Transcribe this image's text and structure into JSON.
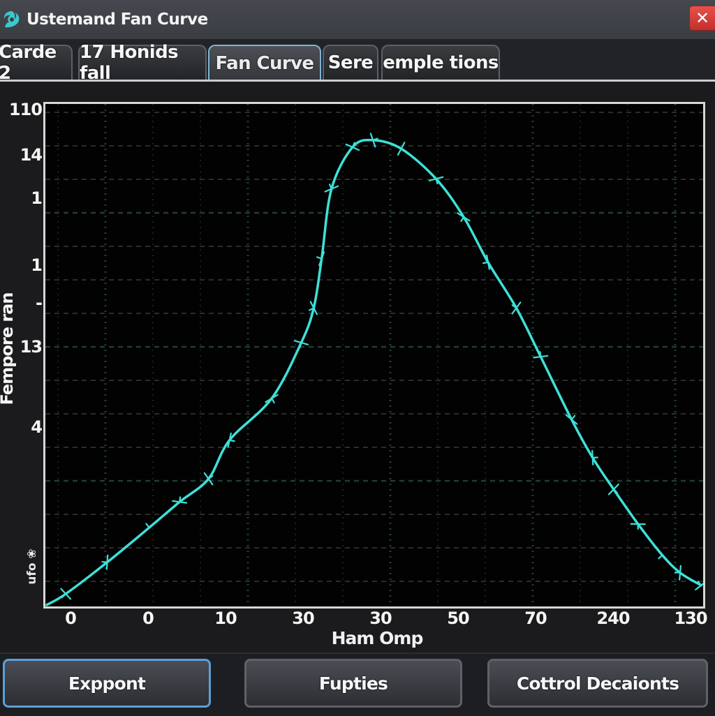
{
  "window": {
    "title": "Ustemand Fan Curve",
    "app_icon": "swirl-fan-icon",
    "close_icon": "close-icon",
    "close_label": "✕"
  },
  "tabs": [
    {
      "label": "Carde 2",
      "active": false
    },
    {
      "label": "17 Honids fall",
      "active": false
    },
    {
      "label": "Fan Curve",
      "active": true
    },
    {
      "label": "Sere",
      "active": false
    },
    {
      "label": "emple tions",
      "active": false
    }
  ],
  "colors": {
    "curve": "#3ee0d8",
    "accent": "#5aa0d8",
    "close": "#d63d38",
    "plot_bg": "#020202",
    "grid": "#3a3a3a"
  },
  "buttons": {
    "export": "Exppont",
    "properties": "Fupties",
    "control": "Cottrol Decaionts"
  },
  "chart_data": {
    "type": "line",
    "title": "",
    "xlabel": "Ham Omp",
    "ylabel": "Fempore ran",
    "ylabel_minor": "ufo ❀",
    "x_tick_labels": [
      "0",
      "0",
      "10",
      "30",
      "30",
      "50",
      "70",
      "240",
      "130"
    ],
    "y_tick_labels": [
      {
        "label": "110",
        "frac": 0.987
      },
      {
        "label": "14",
        "frac": 0.897
      },
      {
        "label": "1",
        "frac": 0.811
      },
      {
        "label": "1",
        "frac": 0.678
      },
      {
        "label": "-",
        "frac": 0.603
      },
      {
        "label": "13",
        "frac": 0.515
      },
      {
        "label": "4",
        "frac": 0.356
      }
    ],
    "grid": true,
    "legend": "none",
    "axis_units": "percent of axis range (labels are non-numeric)",
    "xlim": [
      0,
      100
    ],
    "ylim": [
      0,
      100
    ],
    "series": [
      {
        "name": "fan-curve",
        "x": [
          0.2,
          3.1,
          9.4,
          15.8,
          20.4,
          24.8,
          28.0,
          34.4,
          38.9,
          40.8,
          42.0,
          43.5,
          46.7,
          49.8,
          54.1,
          59.4,
          63.6,
          67.3,
          71.6,
          75.3,
          80.0,
          83.2,
          86.4,
          90.1,
          93.8,
          96.5,
          99.7
        ],
        "y": [
          0.3,
          2.5,
          8.8,
          15.7,
          20.8,
          25.4,
          33.1,
          41.4,
          52.5,
          59.4,
          69.2,
          83.1,
          91.4,
          92.8,
          91.1,
          85.1,
          77.5,
          68.5,
          59.4,
          49.7,
          37.2,
          29.6,
          23.3,
          16.4,
          10.2,
          6.7,
          4.2
        ]
      }
    ]
  }
}
